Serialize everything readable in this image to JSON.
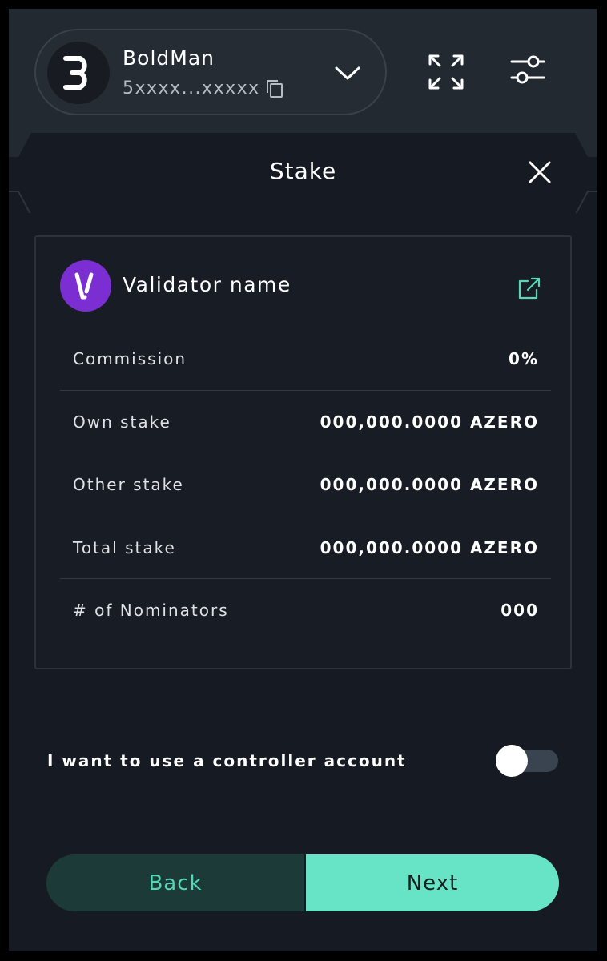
{
  "account": {
    "avatar_letter": "B",
    "name": "BoldMan",
    "address": "5xxxx...xxxxx"
  },
  "stake": {
    "title": "Stake"
  },
  "validator": {
    "logo_letter": "V",
    "name": "Validator name",
    "rows": [
      {
        "label": "Commission",
        "value": "0%"
      },
      {
        "label": "Own stake",
        "value": "000,000.0000 AZERO"
      },
      {
        "label": "Other stake",
        "value": "000,000.0000 AZERO"
      },
      {
        "label": "Total stake",
        "value": "000,000.0000 AZERO"
      },
      {
        "label": "# of Nominators",
        "value": "000"
      }
    ]
  },
  "controller": {
    "label": "I want to use a controller account",
    "enabled": false
  },
  "buttons": {
    "back_label": "Back",
    "next_label": "Next"
  },
  "colors": {
    "background": "#161b23",
    "accent": "#66e4c5",
    "validator_purple": "#7b2fd3"
  },
  "icons": [
    "copy-icon",
    "chevron-down-icon",
    "expand-icon",
    "settings-icon",
    "close-icon",
    "external-link-icon"
  ]
}
